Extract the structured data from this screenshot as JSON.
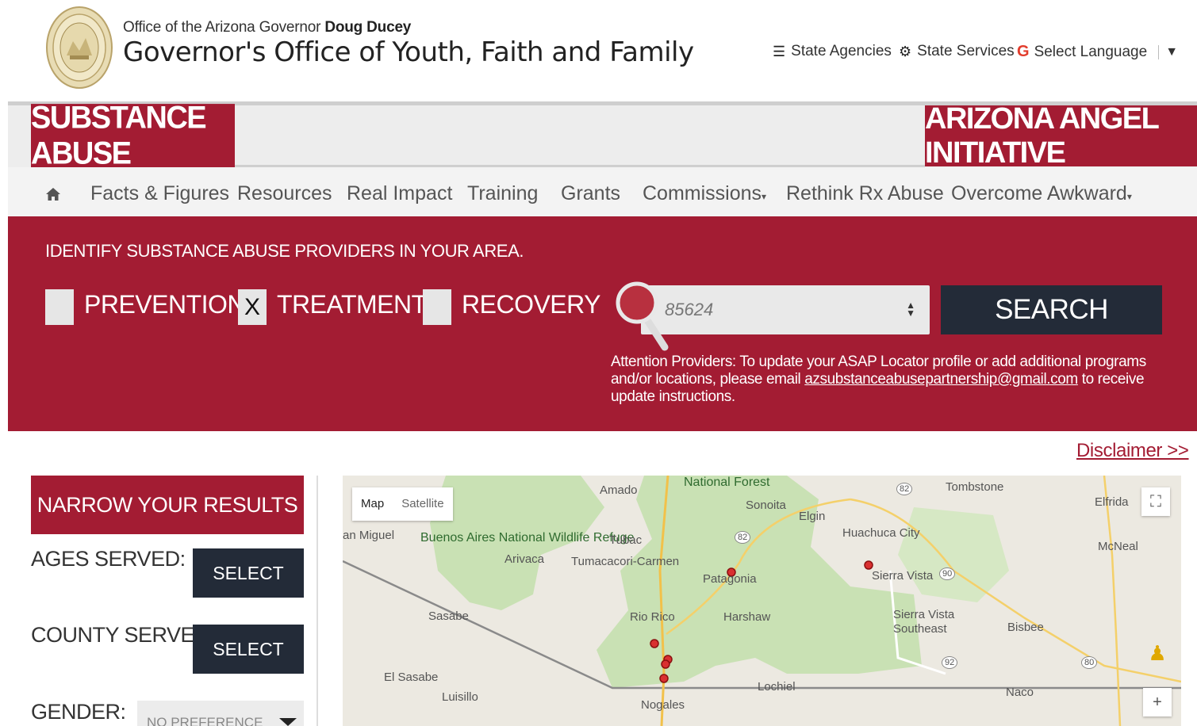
{
  "header": {
    "office_prefix": "Office of the Arizona Governor",
    "governor_name": "Doug Ducey",
    "title": "Governor's Office of Youth, Faith and Family",
    "state_agencies": "State Agencies",
    "state_services": "State Services",
    "select_language": "Select Language"
  },
  "banner": {
    "left_tag": "SUBSTANCE ABUSE",
    "right_tag": "ARIZONA ANGEL INITIATIVE"
  },
  "nav": {
    "items": [
      {
        "label": "Facts & Figures"
      },
      {
        "label": "Resources"
      },
      {
        "label": "Real Impact"
      },
      {
        "label": "Training"
      },
      {
        "label": "Grants"
      },
      {
        "label": "Commissions"
      },
      {
        "label": "Rethink Rx Abuse"
      },
      {
        "label": "Overcome Awkward"
      }
    ]
  },
  "search": {
    "heading": "IDENTIFY SUBSTANCE ABUSE PROVIDERS IN YOUR AREA.",
    "options": [
      {
        "label": "PREVENTION",
        "mark": ""
      },
      {
        "label": "TREATMENT",
        "mark": "X"
      },
      {
        "label": "RECOVERY",
        "mark": ""
      }
    ],
    "zip_value": "85624",
    "button": "SEARCH",
    "notice_pre": "Attention Providers: To update your ASAP Locator profile or add additional programs and/or locations, please email",
    "notice_email": "azsubstanceabusepartnership@gmail.com",
    "notice_post": "to receive update instructions."
  },
  "disclaimer": "Disclaimer >>",
  "filters": {
    "heading": "NARROW YOUR RESULTS",
    "ages_label": "AGES SERVED:",
    "county_label": "COUNTY SERVED:",
    "gender_label": "GENDER:",
    "select_label": "SELECT",
    "gender_value": "NO PREFERENCE"
  },
  "map": {
    "type_map": "Map",
    "type_satellite": "Satellite",
    "places": {
      "amado": "Amado",
      "national_forest": "National Forest",
      "tombstone": "Tombstone",
      "elfrida": "Elfrida",
      "sonoita": "Sonoita",
      "elgin": "Elgin",
      "huachuca": "Huachuca City",
      "san_miguel": "an Miguel",
      "buenos_aires": "Buenos Aires National Wildlife Refuge",
      "arivaca": "Arivaca",
      "tubac": "Tubac",
      "tumacacori": "Tumacacori-Carmen",
      "mcneal": "McNeal",
      "patagonia": "Patagonia",
      "sierra_vista": "Sierra Vista",
      "sasabe": "Sasabe",
      "rio_rico": "Rio Rico",
      "harshaw": "Harshaw",
      "sierra_vista_se": "Sierra Vista Southeast",
      "bisbee": "Bisbee",
      "el_sasabe": "El Sasabe",
      "luisillo": "Luisillo",
      "lochiel": "Lochiel",
      "naco": "Naco",
      "nogales": "Nogales"
    },
    "routes": [
      "82",
      "82",
      "90",
      "92",
      "80"
    ]
  }
}
